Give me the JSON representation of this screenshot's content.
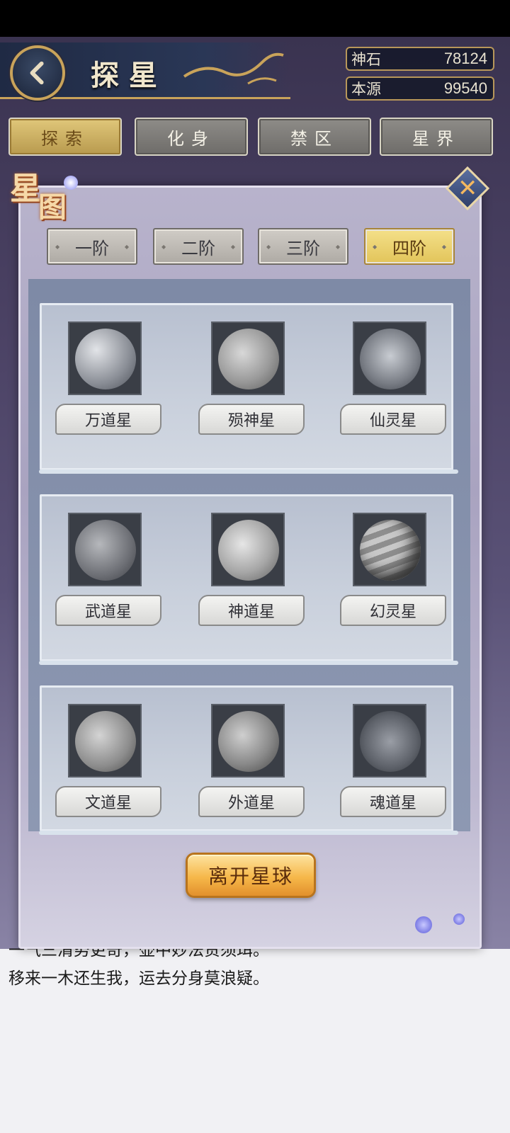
{
  "header": {
    "title": "探星",
    "currencies": [
      {
        "label": "神石",
        "value": "78124"
      },
      {
        "label": "本源",
        "value": "99540"
      }
    ]
  },
  "main_tabs": [
    {
      "label": "探索",
      "active": true
    },
    {
      "label": "化身",
      "active": false
    },
    {
      "label": "禁区",
      "active": false
    },
    {
      "label": "星界",
      "active": false
    }
  ],
  "panel": {
    "emblem": [
      "星",
      "图"
    ],
    "tiers": [
      {
        "label": "一阶",
        "active": false
      },
      {
        "label": "二阶",
        "active": false
      },
      {
        "label": "三阶",
        "active": false
      },
      {
        "label": "四阶",
        "active": true
      }
    ],
    "planets": [
      {
        "name": "万道星",
        "icon": "cratered-planet-icon"
      },
      {
        "name": "殒神星",
        "icon": "ringed-cratered-planet-icon"
      },
      {
        "name": "仙灵星",
        "icon": "sparkling-planet-icon"
      },
      {
        "name": "武道星",
        "icon": "planet-with-moon-icon"
      },
      {
        "name": "神道星",
        "icon": "misty-planet-icon"
      },
      {
        "name": "幻灵星",
        "icon": "gas-giant-ringed-icon"
      },
      {
        "name": "文道星",
        "icon": "moon-orbit-planet-icon"
      },
      {
        "name": "外道星",
        "icon": "dark-spotted-planet-icon"
      },
      {
        "name": "魂道星",
        "icon": "glowing-particle-planet-icon"
      }
    ],
    "leave_button": "离开星球"
  },
  "poem": {
    "line1": "一气三清势更奇，壶中妙法贵须珥。",
    "line2": "移来一木还生我，运去分身莫浪疑。"
  }
}
